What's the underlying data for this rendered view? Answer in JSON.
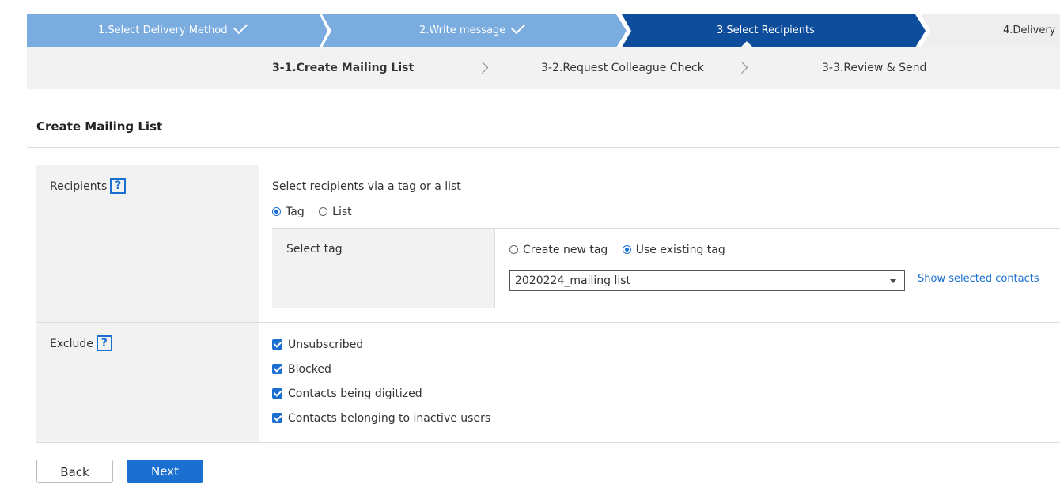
{
  "wizard": {
    "steps": [
      {
        "label": "1.Select Delivery Method",
        "done": true
      },
      {
        "label": "2.Write message",
        "done": true
      },
      {
        "label": "3.Select Recipients",
        "active": true
      },
      {
        "label": "4.Delivery"
      }
    ],
    "substeps": [
      {
        "label": "3-1.Create Mailing List",
        "active": true
      },
      {
        "label": "3-2.Request Colleague Check"
      },
      {
        "label": "3-3.Review & Send"
      }
    ]
  },
  "page": {
    "title": "Create Mailing List"
  },
  "form": {
    "recipients": {
      "label": "Recipients",
      "instruction": "Select recipients via a tag or a list",
      "options": [
        {
          "label": "Tag",
          "selected": true
        },
        {
          "label": "List",
          "selected": false
        }
      ],
      "select_tag": {
        "label": "Select tag",
        "options": [
          {
            "label": "Create new tag",
            "selected": false
          },
          {
            "label": "Use existing tag",
            "selected": true
          }
        ],
        "dropdown_value": "2020224_mailing list",
        "show_link": "Show selected contacts"
      }
    },
    "exclude": {
      "label": "Exclude",
      "items": [
        {
          "label": "Unsubscribed",
          "checked": true
        },
        {
          "label": "Blocked",
          "checked": true
        },
        {
          "label": "Contacts being digitized",
          "checked": true
        },
        {
          "label": "Contacts belonging to inactive users",
          "checked": true
        }
      ]
    }
  },
  "buttons": {
    "back": "Back",
    "next": "Next"
  },
  "colors": {
    "accent": "#1a6fd0",
    "step_done": "#7aace0",
    "step_active": "#0e4c9c",
    "step_pending": "#eeeeee"
  }
}
